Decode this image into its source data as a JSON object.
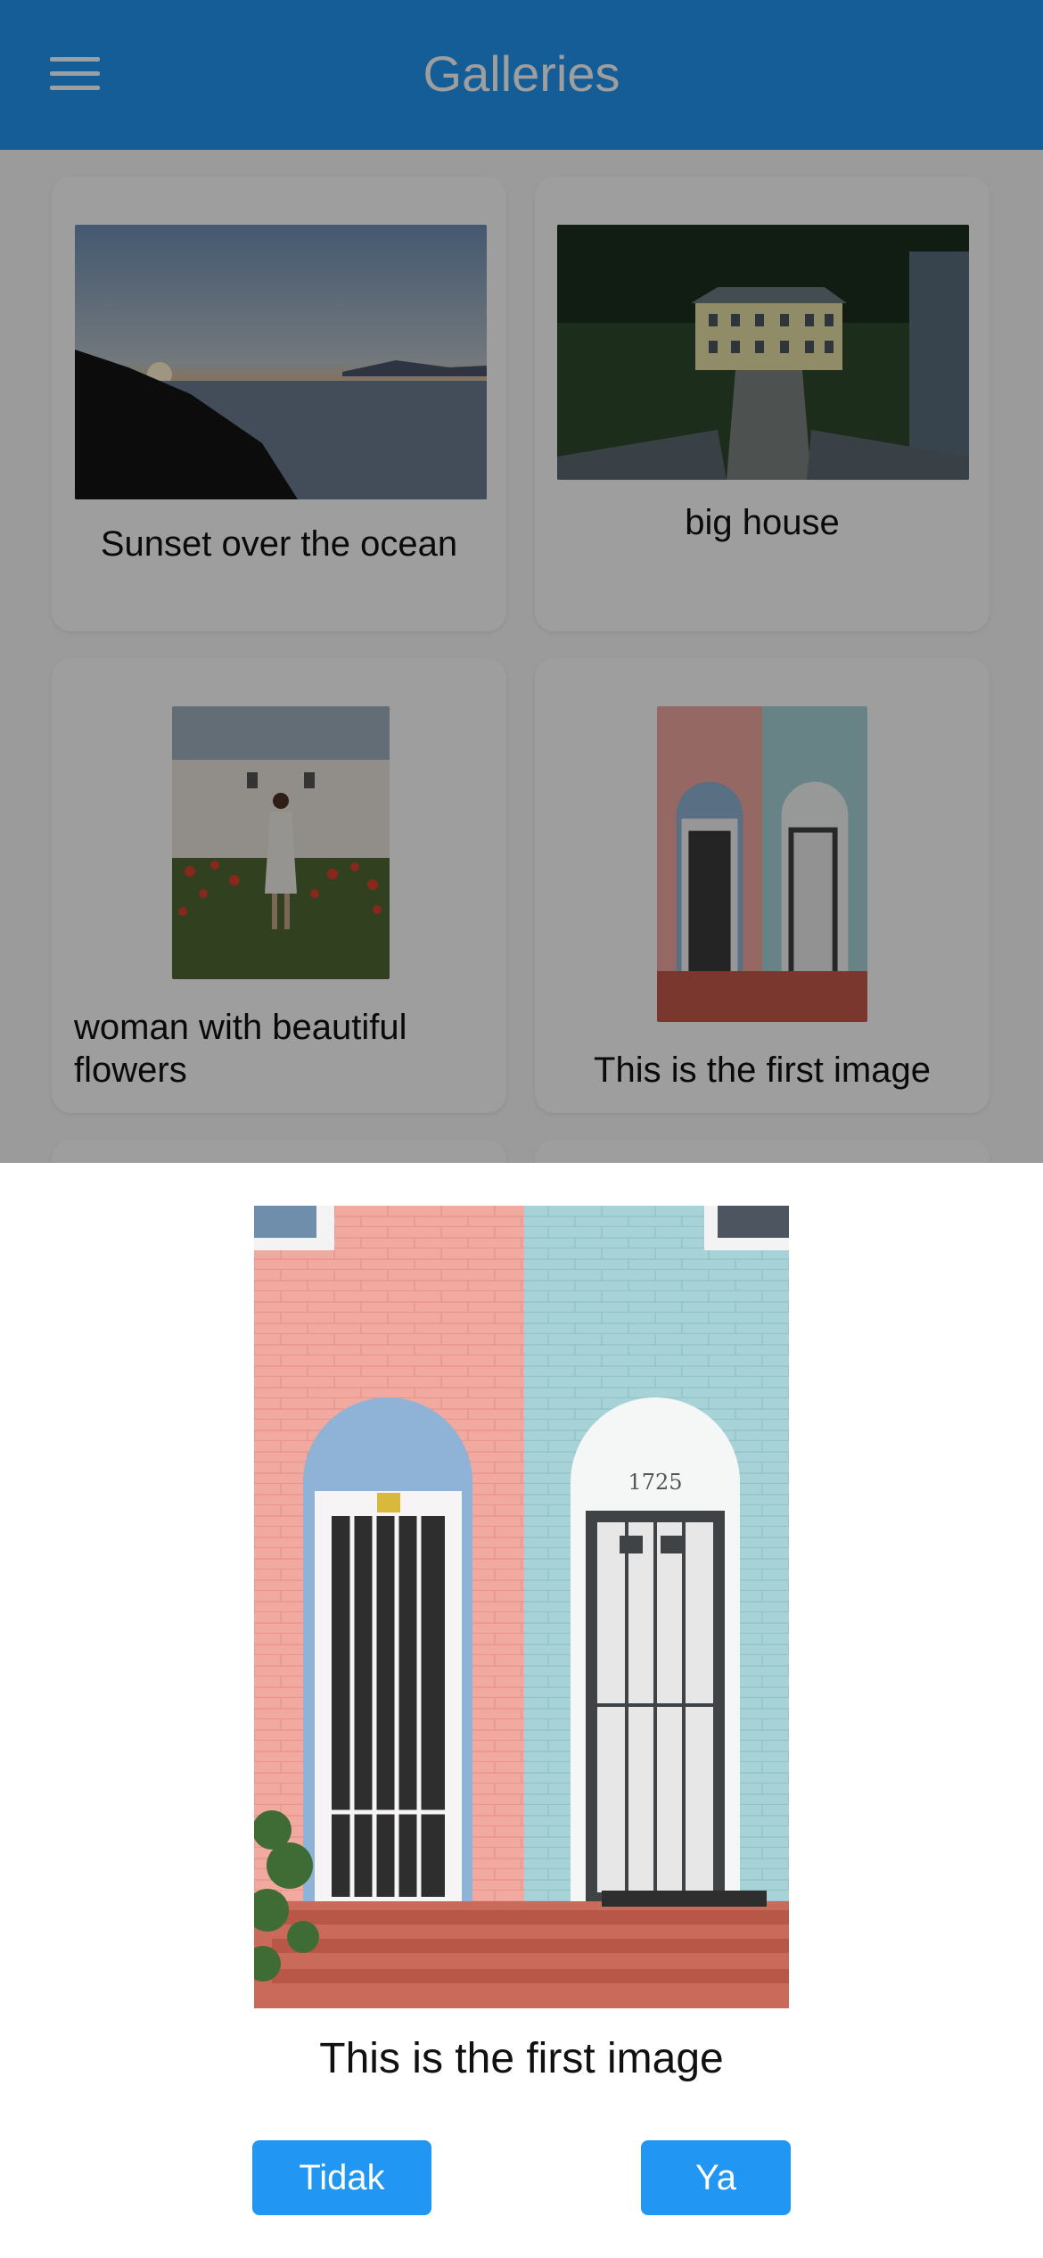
{
  "app_bar": {
    "title": "Galleries",
    "menu_icon": "hamburger-menu-icon"
  },
  "gallery": {
    "items": [
      {
        "caption": "Sunset over the ocean"
      },
      {
        "caption": "big house"
      },
      {
        "caption": "woman with beautiful flowers"
      },
      {
        "caption": "This is the first image"
      }
    ]
  },
  "dialog": {
    "caption": "This is the first image",
    "no_label": "Tidak",
    "yes_label": "Ya"
  },
  "colors": {
    "primary": "#2196F3",
    "scrim": "rgba(0,0,0,0.38)"
  }
}
